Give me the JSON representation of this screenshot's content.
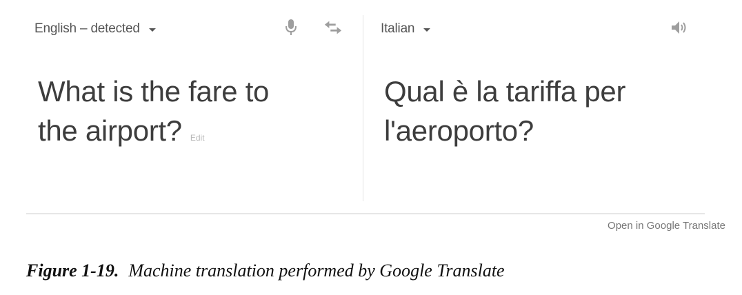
{
  "source": {
    "language_label": "English – detected",
    "text_line1": "What is the fare to",
    "text_line2": "the airport?",
    "edit_label": "Edit",
    "mic_icon": "microphone-icon",
    "swap_icon": "swap-languages-icon"
  },
  "target": {
    "language_label": "Italian",
    "text_line1": "Qual è la tariffa per",
    "text_line2": "l'aeroporto?",
    "speaker_icon": "speaker-icon"
  },
  "footer": {
    "open_link": "Open in Google Translate"
  },
  "caption": {
    "figure_number": "Figure 1-19.",
    "text": "Machine translation performed by Google Translate"
  },
  "colors": {
    "text": "#3d3d3d",
    "icon": "#9e9e9e",
    "divider": "#e2e2e2"
  }
}
